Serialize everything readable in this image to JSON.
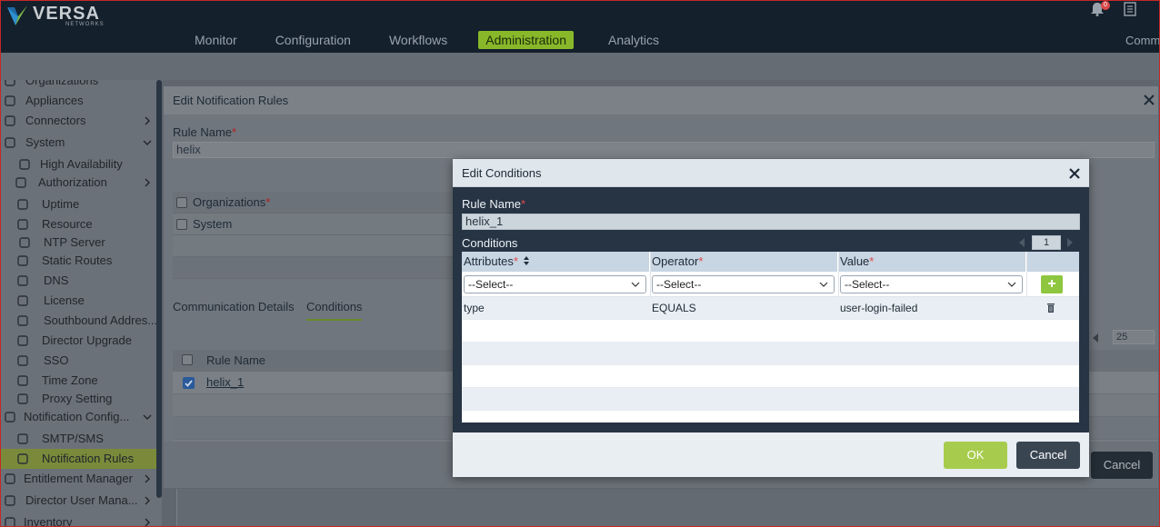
{
  "brand": {
    "name": "VERSA",
    "sub": "NETWORKS"
  },
  "nav": {
    "items": [
      "Monitor",
      "Configuration",
      "Workflows",
      "Administration",
      "Analytics"
    ],
    "active": "Administration",
    "overflow": "Comm",
    "notification_count": "0"
  },
  "sidebar": {
    "items": [
      {
        "label": "Organizations",
        "icon": "organizations-icon"
      },
      {
        "label": "Appliances",
        "icon": "appliances-icon"
      },
      {
        "label": "Connectors",
        "icon": "connectors-icon",
        "expandable": true
      },
      {
        "label": "System",
        "icon": "system-icon",
        "expanded": true
      },
      {
        "label": "High Availability",
        "icon": "high-availability-icon"
      },
      {
        "label": "Authorization",
        "icon": "authorization-icon",
        "expandable": true
      },
      {
        "label": "Uptime",
        "icon": "uptime-icon"
      },
      {
        "label": "Resource",
        "icon": "resource-icon"
      },
      {
        "label": "NTP Server",
        "icon": "ntp-server-icon"
      },
      {
        "label": "Static Routes",
        "icon": "static-routes-icon"
      },
      {
        "label": "DNS",
        "icon": "dns-icon"
      },
      {
        "label": "License",
        "icon": "license-icon"
      },
      {
        "label": "Southbound Addres...",
        "icon": "southbound-address-icon"
      },
      {
        "label": "Director Upgrade",
        "icon": "director-upgrade-icon"
      },
      {
        "label": "SSO",
        "icon": "sso-icon"
      },
      {
        "label": "Time Zone",
        "icon": "time-zone-icon"
      },
      {
        "label": "Proxy Setting",
        "icon": "proxy-setting-icon"
      },
      {
        "label": "Notification Config...",
        "icon": "notification-config-icon",
        "expanded": true
      },
      {
        "label": "SMTP/SMS",
        "icon": "smtp-sms-icon"
      },
      {
        "label": "Notification Rules",
        "icon": "notification-rules-icon",
        "active": true
      },
      {
        "label": "Entitlement Manager",
        "icon": "entitlement-manager-icon",
        "expandable": true
      },
      {
        "label": "Director User Mana...",
        "icon": "director-user-management-icon",
        "expandable": true
      },
      {
        "label": "Inventory",
        "icon": "inventory-icon",
        "expandable": true
      }
    ]
  },
  "notification_dialog": {
    "title": "Edit Notification Rules",
    "rule_name_label": "Rule Name",
    "rule_name_value": "helix",
    "org_rows": [
      "Organizations",
      "System"
    ],
    "tabs": [
      "Communication Details",
      "Conditions"
    ],
    "active_tab": "Conditions",
    "grid_header": "Rule Name",
    "grid_rows": [
      "helix_1"
    ],
    "page_size": "25",
    "cancel_label": "Cancel"
  },
  "conditions_dialog": {
    "title": "Edit Conditions",
    "rule_name_label": "Rule Name",
    "rule_name_value": "helix_1",
    "conditions_label": "Conditions",
    "page": "1",
    "columns": [
      "Attributes",
      "Operator",
      "Value"
    ],
    "select_placeholder": "--Select--",
    "rows": [
      {
        "attribute": "type",
        "operator": "EQUALS",
        "value": "user-login-failed"
      }
    ],
    "ok_label": "OK",
    "cancel_label": "Cancel"
  },
  "colors": {
    "accent": "#8ec63f",
    "topbar": "#14202c",
    "dialog_body": "#263444",
    "required": "#e0484b"
  }
}
